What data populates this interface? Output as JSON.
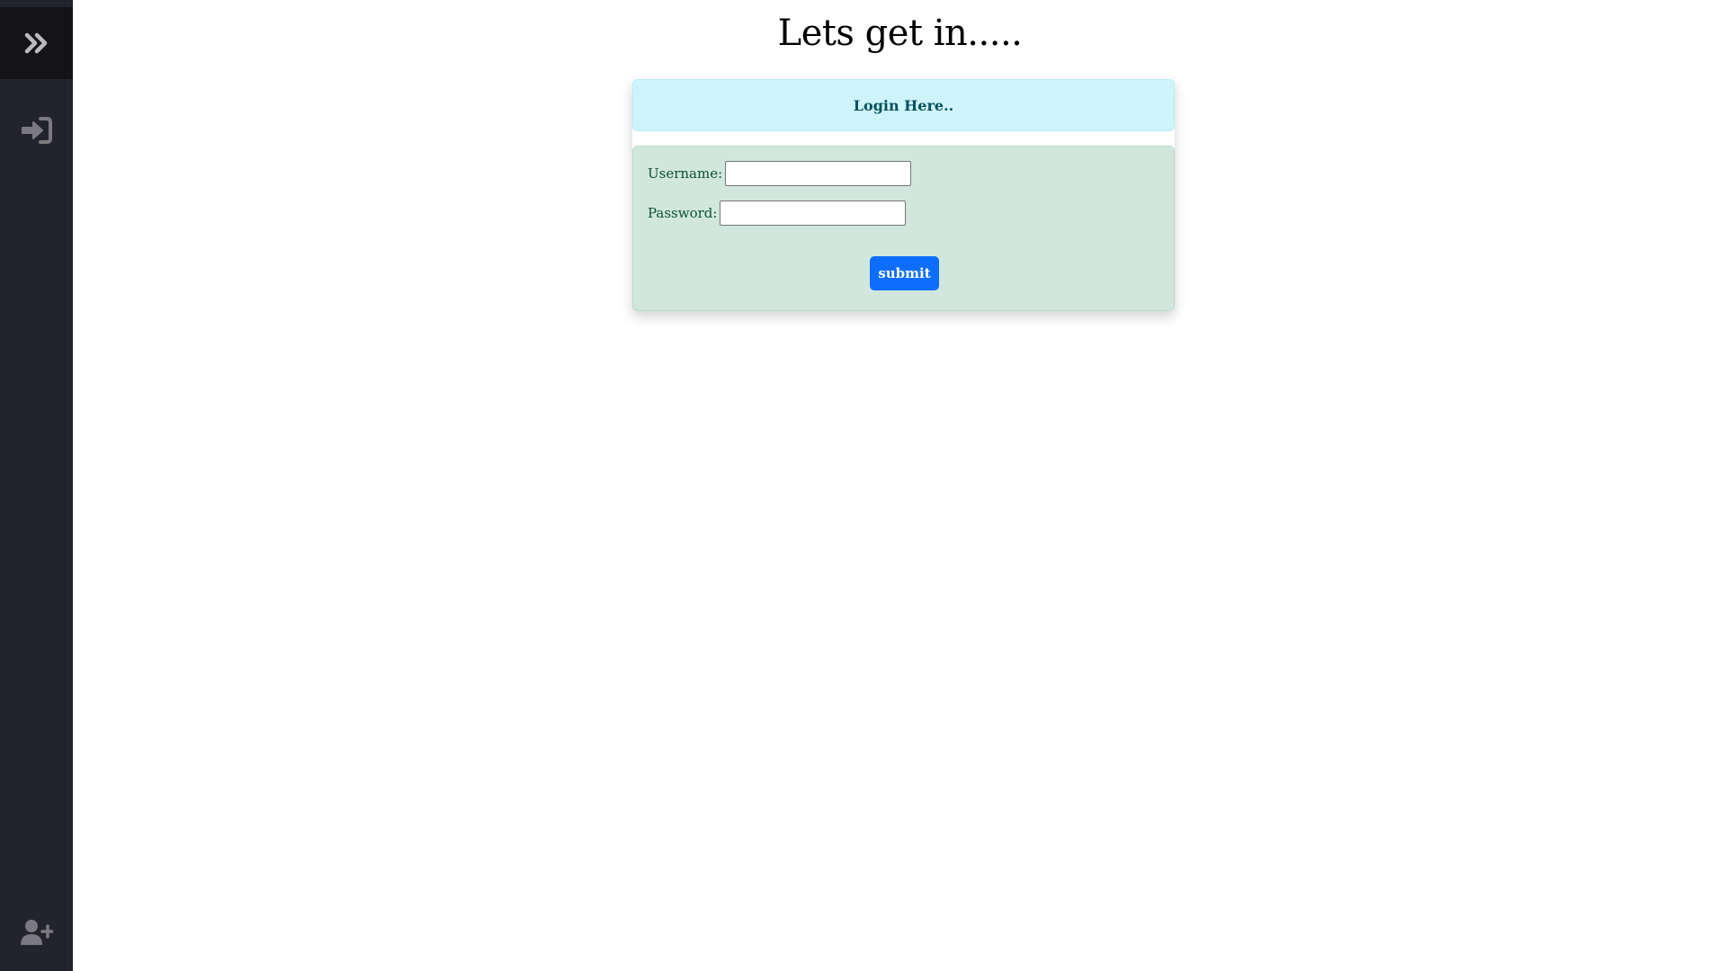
{
  "sidebar": {
    "toggle_icon": "double-chevron-right-icon",
    "items": [
      {
        "name": "login",
        "icon": "sign-in-icon"
      },
      {
        "name": "signup",
        "icon": "user-plus-icon"
      }
    ],
    "colors": {
      "background": "#23232e",
      "top": "#141418",
      "icon": "#7a7a80",
      "toggle_icon": "#b9b9bf"
    }
  },
  "page": {
    "title": "Lets get in....."
  },
  "card": {
    "header": "Login Here..",
    "username_label": "Username:",
    "username_value": "",
    "password_label": "Password:",
    "password_value": "",
    "submit_label": "submit",
    "colors": {
      "header_bg": "#cff4fc",
      "body_bg": "#d1e7dd",
      "button_bg": "#0d6efd"
    }
  }
}
